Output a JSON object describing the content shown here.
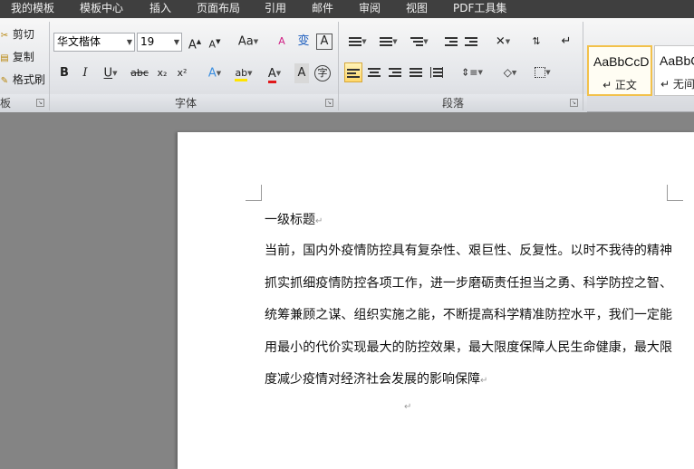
{
  "tabs": [
    "我的模板",
    "模板中心",
    "插入",
    "页面布局",
    "引用",
    "邮件",
    "审阅",
    "视图",
    "PDF工具集"
  ],
  "clipboard": {
    "cut": "剪切",
    "copy": "复制",
    "format_painter": "格式刷",
    "label": "板"
  },
  "font": {
    "name": "华文楷体",
    "size": "19",
    "label": "字体",
    "grow": "A",
    "shrink": "A",
    "change_case": "Aa",
    "clear_format": "A",
    "phonetic": "变",
    "char_border": "A",
    "bold": "B",
    "italic": "I",
    "underline": "U",
    "strikethrough": "abc",
    "subscript": "x₂",
    "superscript": "x²",
    "text_effect": "A",
    "highlight": "ab",
    "font_color": "A",
    "char_shading": "A",
    "enclose": "字",
    "highlight_color": "#ffe400",
    "font_color_value": "#e0181b"
  },
  "paragraph": {
    "label": "段落"
  },
  "styles": [
    {
      "sample": "AaBbCcD",
      "name": "↵ 正文"
    },
    {
      "sample": "AaBbC",
      "name": "↵ 无间"
    }
  ],
  "document": {
    "heading": "一级标题",
    "body": "当前，国内外疫情防控具有复杂性、艰巨性、反复性。以时不我待的精神抓实抓细疫情防控各项工作，进一步磨砺责任担当之勇、科学防控之智、统筹兼顾之谋、组织实施之能，不断提高科学精准防控水平，我们一定能用最小的代价实现最大的防控效果，最大限度保障人民生命健康，最大限度减少疫情对经济社会发展的影响保障",
    "para_mark": "↵"
  },
  "accent": "#f2c14b"
}
